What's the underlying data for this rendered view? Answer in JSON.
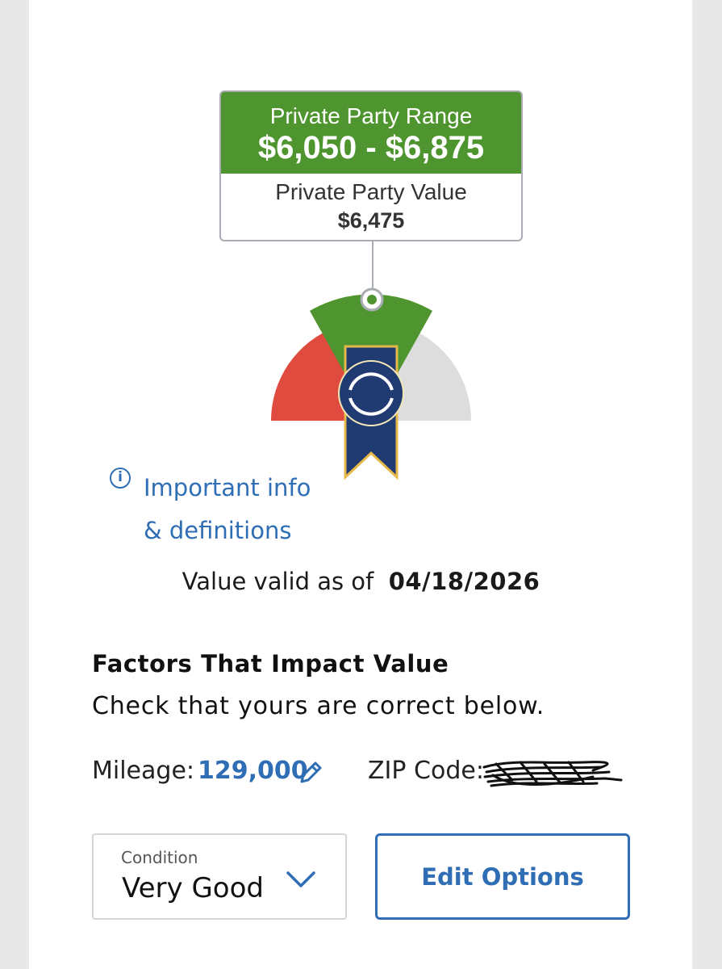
{
  "value_box": {
    "range_label": "Private Party Range",
    "range_value": "$6,050 - $6,875",
    "value_label": "Private Party Value",
    "value_amount": "$6,475"
  },
  "gauge": {
    "colors": {
      "low": "#e04b3f",
      "mid": "#4f952f",
      "high": "#dddddd",
      "badge": "#203a72",
      "badge_edge": "#e5b84a"
    }
  },
  "info": {
    "icon_glyph": "i",
    "line1": "Important info",
    "line2": "& definitions"
  },
  "valid": {
    "label": "Value valid as of",
    "date": "04/18/2026"
  },
  "factors": {
    "title": "Factors That Impact Value",
    "subtitle": "Check that yours are correct below.",
    "mileage_label": "Mileage:",
    "mileage_value": "129,000",
    "zip_label": "ZIP Code:"
  },
  "condition": {
    "label": "Condition",
    "value": "Very Good"
  },
  "edit_button": {
    "label": "Edit Options"
  },
  "colors": {
    "accent": "#2f6eb5",
    "green": "#4f952f"
  }
}
